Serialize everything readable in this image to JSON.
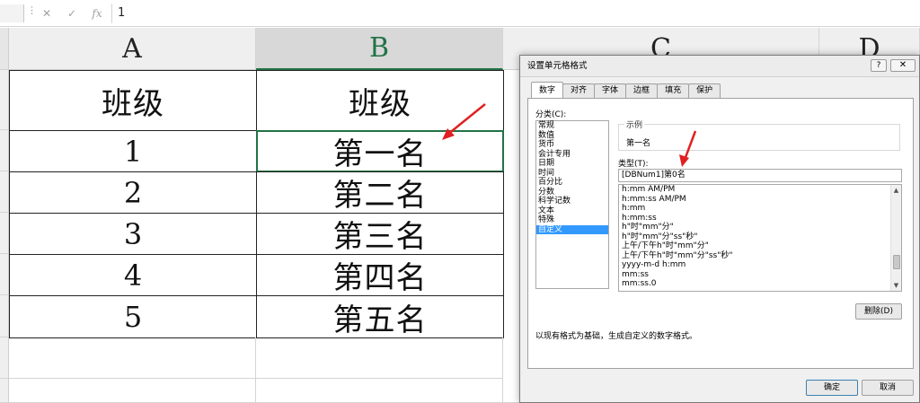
{
  "formula_bar": {
    "cancel_icon": "✕",
    "enter_icon": "✓",
    "fx_icon": "fx",
    "value": "1"
  },
  "sheet": {
    "columns": [
      "A",
      "B",
      "C",
      "D"
    ],
    "rows": [
      {
        "a": "班级",
        "b": "班级"
      },
      {
        "a": "1",
        "b": "第一名"
      },
      {
        "a": "2",
        "b": "第二名"
      },
      {
        "a": "3",
        "b": "第三名"
      },
      {
        "a": "4",
        "b": "第四名"
      },
      {
        "a": "5",
        "b": "第五名"
      }
    ],
    "selected_column": "B",
    "accent_color": "#217346"
  },
  "dialog": {
    "title": "设置单元格格式",
    "help": "?",
    "close": "✕",
    "tabs": [
      {
        "label": "数字"
      },
      {
        "label": "对齐"
      },
      {
        "label": "字体"
      },
      {
        "label": "边框"
      },
      {
        "label": "填充"
      },
      {
        "label": "保护"
      }
    ],
    "category_label": "分类(C):",
    "categories": [
      "常规",
      "数值",
      "货币",
      "会计专用",
      "日期",
      "时间",
      "百分比",
      "分数",
      "科学记数",
      "文本",
      "特殊",
      "自定义"
    ],
    "selected_category": "自定义",
    "sample_label": "示例",
    "sample_value": "第一名",
    "type_label": "类型(T):",
    "type_value": "[DBNum1]第0名",
    "type_list": [
      "h:mm AM/PM",
      "h:mm:ss AM/PM",
      "h:mm",
      "h:mm:ss",
      "h\"时\"mm\"分\"",
      "h\"时\"mm\"分\"ss\"秒\"",
      "上午/下午h\"时\"mm\"分\"",
      "上午/下午h\"时\"mm\"分\"ss\"秒\"",
      "yyyy-m-d h:mm",
      "mm:ss",
      "mm:ss.0"
    ],
    "delete_label": "删除(D)",
    "description": "以现有格式为基础，生成自定义的数字格式。",
    "ok_label": "确定",
    "cancel_label": "取消"
  },
  "annotation_color": "#e02020"
}
